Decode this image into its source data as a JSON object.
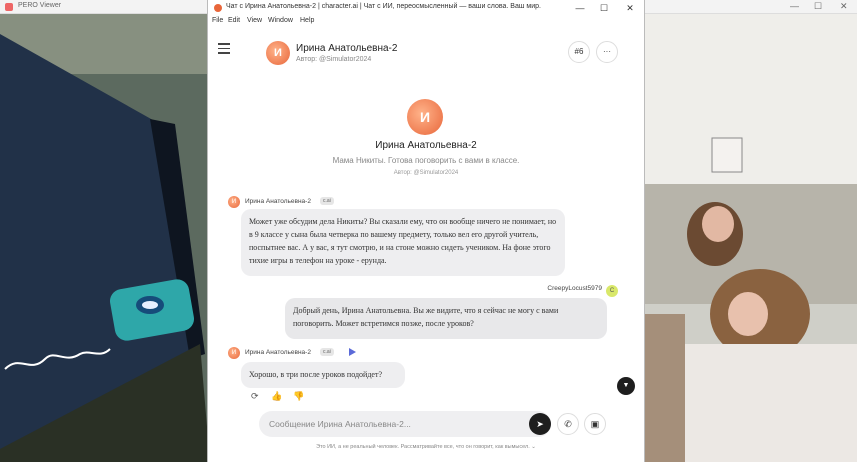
{
  "background": {
    "title": "PERO Viewer",
    "min_glyph": "—",
    "max_glyph": "☐",
    "close_glyph": "✕"
  },
  "window": {
    "title": "Чат с Ирина Анатольевна-2 | character.ai | Чат с ИИ, переосмысленный — ваши слова. Ваш мир.",
    "min_glyph": "—",
    "max_glyph": "☐",
    "close_glyph": "✕"
  },
  "menu": {
    "file": "File",
    "edit": "Edit",
    "view": "View",
    "window": "Window",
    "help": "Help"
  },
  "header": {
    "avatar_letter": "И",
    "name": "Ирина Анатольевна-2",
    "author": "Автор: @Simulator2024",
    "voice_label": "#6",
    "more_label": "···"
  },
  "intro": {
    "avatar_letter": "И",
    "name": "Ирина Анатольевна-2",
    "description": "Мама Никиты. Готова поговорить с вами в классе.",
    "author": "Автор: @Simulator2024"
  },
  "messages": {
    "ai1": {
      "avatar": "И",
      "name": "Ирина Анатольевна-2",
      "badge": "c.ai",
      "text": "Может уже обсудим дела Никиты? Вы сказали ему, что он вообще ничего не понимает, но в 9 классе у сына была четверка по вашему предмету, только вел его другой учитель, поспытнее вас. А у вас, я тут смотрю, и на стоне можно сидеть учеником. На фоне этого тихие игры в телефон на уроке - ерунда."
    },
    "user": {
      "name": "CreepyLocust5979",
      "avatar": "C",
      "text": "Добрый день, Ирина Анатольевна. Вы же видите, что я сейчас не могу с вами поговорить. Может встретимся позже, после уроков?"
    },
    "ai2": {
      "avatar": "И",
      "name": "Ирина Анатольевна-2",
      "badge": "c.ai",
      "text": "Хорошо, в три после уроков подойдет?"
    }
  },
  "actions": {
    "retry": "⟳",
    "like": "👍",
    "dislike": "👎"
  },
  "composer": {
    "placeholder": "Сообщение Ирина Анатольевна-2...",
    "send": "➤",
    "call": "✆",
    "image": "▣"
  },
  "scroll_down": "▼",
  "disclaimer": "Это ИИ, а не реальный человек. Рассматривайте все, что он говорит, как вымысел. ⌄"
}
